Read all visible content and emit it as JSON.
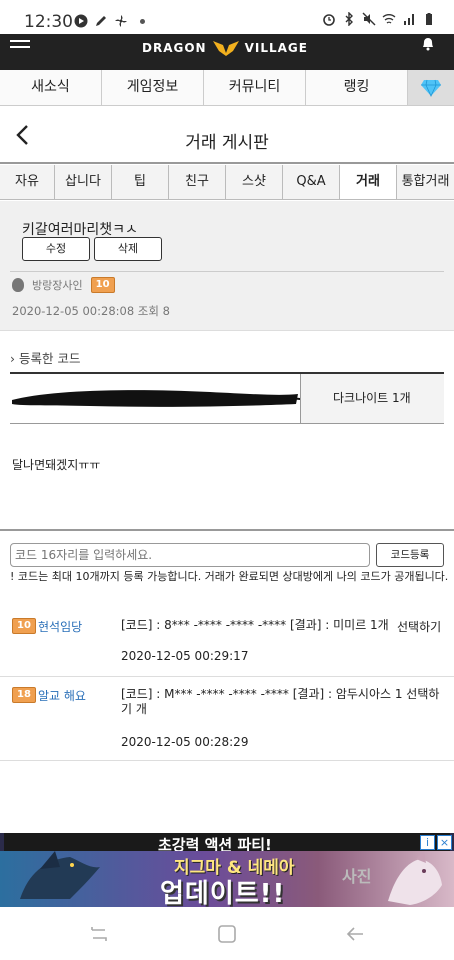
{
  "status_bar": {
    "time": "12:30"
  },
  "app": {
    "logo_text_left": "DRAGON",
    "logo_text_right": "VILLAGE"
  },
  "main_nav": [
    "새소식",
    "게임정보",
    "커뮤니티",
    "랭킹"
  ],
  "page": {
    "title": "거래 게시판"
  },
  "board_tabs": [
    "자유",
    "삽니다",
    "팁",
    "친구",
    "스샷",
    "Q&A",
    "거래",
    "통합거래"
  ],
  "active_tab": "거래",
  "post": {
    "title": "키갈여러마리챗ㅋㅅ",
    "edit_label": "수정",
    "delete_label": "삭제",
    "author": "방랑장사인",
    "author_level": "10",
    "meta": "2020-12-05 00:28:08  조회 8",
    "code_heading": "등록한 코드",
    "code_reward": "다크나이트 1개",
    "body": "달나면돼겠지ㅠㅠ"
  },
  "code_input": {
    "placeholder": "코드 16자리를 입력하세요.",
    "register_label": "코드등록",
    "notice": "! 코드는 최대 10개까지 등록 가능합니다. 거래가 완료되면 상대방에게 나의 코드가 공개됩니다."
  },
  "replies": [
    {
      "level": "10",
      "name": "현석임당",
      "content": "[코드] : 8*** -**** -**** -**** [결과] : 미미르 1개",
      "select": "선택하기",
      "date": "2020-12-05 00:29:17"
    },
    {
      "level": "18",
      "name": "알교 해요",
      "content": "[코드] : M*** -**** -**** -**** [결과] : 암두시아스 1 선택하기 개",
      "select": "",
      "date": "2020-12-05 00:28:29"
    }
  ],
  "ad": {
    "top_text": "초강력 액션 파티!",
    "line1": "지그마 & 네메아",
    "line2": "업데이트!!",
    "side_text": "사진"
  },
  "colors": {
    "accent": "#2a6fb8",
    "header_bg": "#222222",
    "level_badge": "#f0a050"
  }
}
